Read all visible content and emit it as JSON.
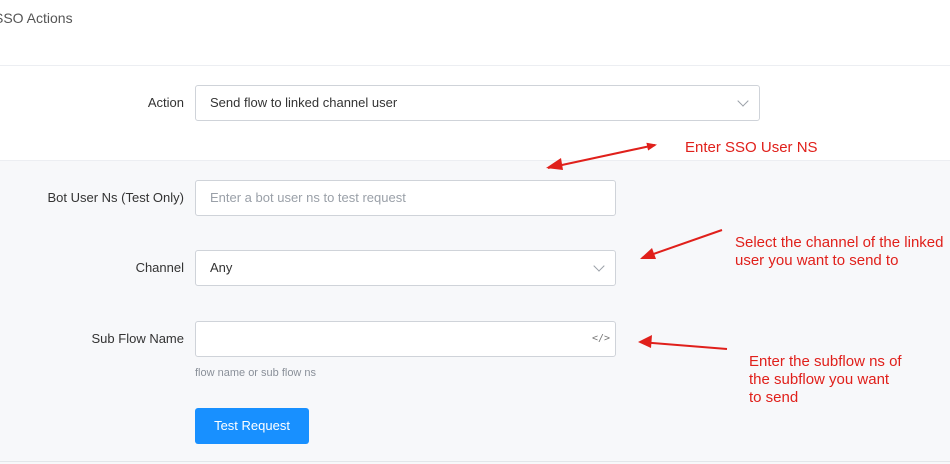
{
  "header": {
    "title": "SSO Actions"
  },
  "action": {
    "label": "Action",
    "value": "Send flow to linked channel user"
  },
  "form": {
    "bot_user_ns": {
      "label": "Bot User Ns (Test Only)",
      "placeholder": "Enter a bot user ns to test request"
    },
    "channel": {
      "label": "Channel",
      "value": "Any"
    },
    "sub_flow": {
      "label": "Sub Flow Name",
      "value": "",
      "helper": "flow name or sub flow ns",
      "icon": "code-icon"
    },
    "test_button": {
      "label": "Test Request"
    }
  },
  "annotations": {
    "sso_user_ns": [
      "Enter SSO User NS"
    ],
    "channel": [
      "Select the channel of the linked",
      "user you want to send to"
    ],
    "subflow": [
      "Enter the subflow ns of",
      "the subflow you want",
      "to send"
    ],
    "color": "#e0201b"
  },
  "colors": {
    "accent": "#1890ff",
    "section_bg": "#f7f8fa",
    "border": "#cfd3d9"
  }
}
